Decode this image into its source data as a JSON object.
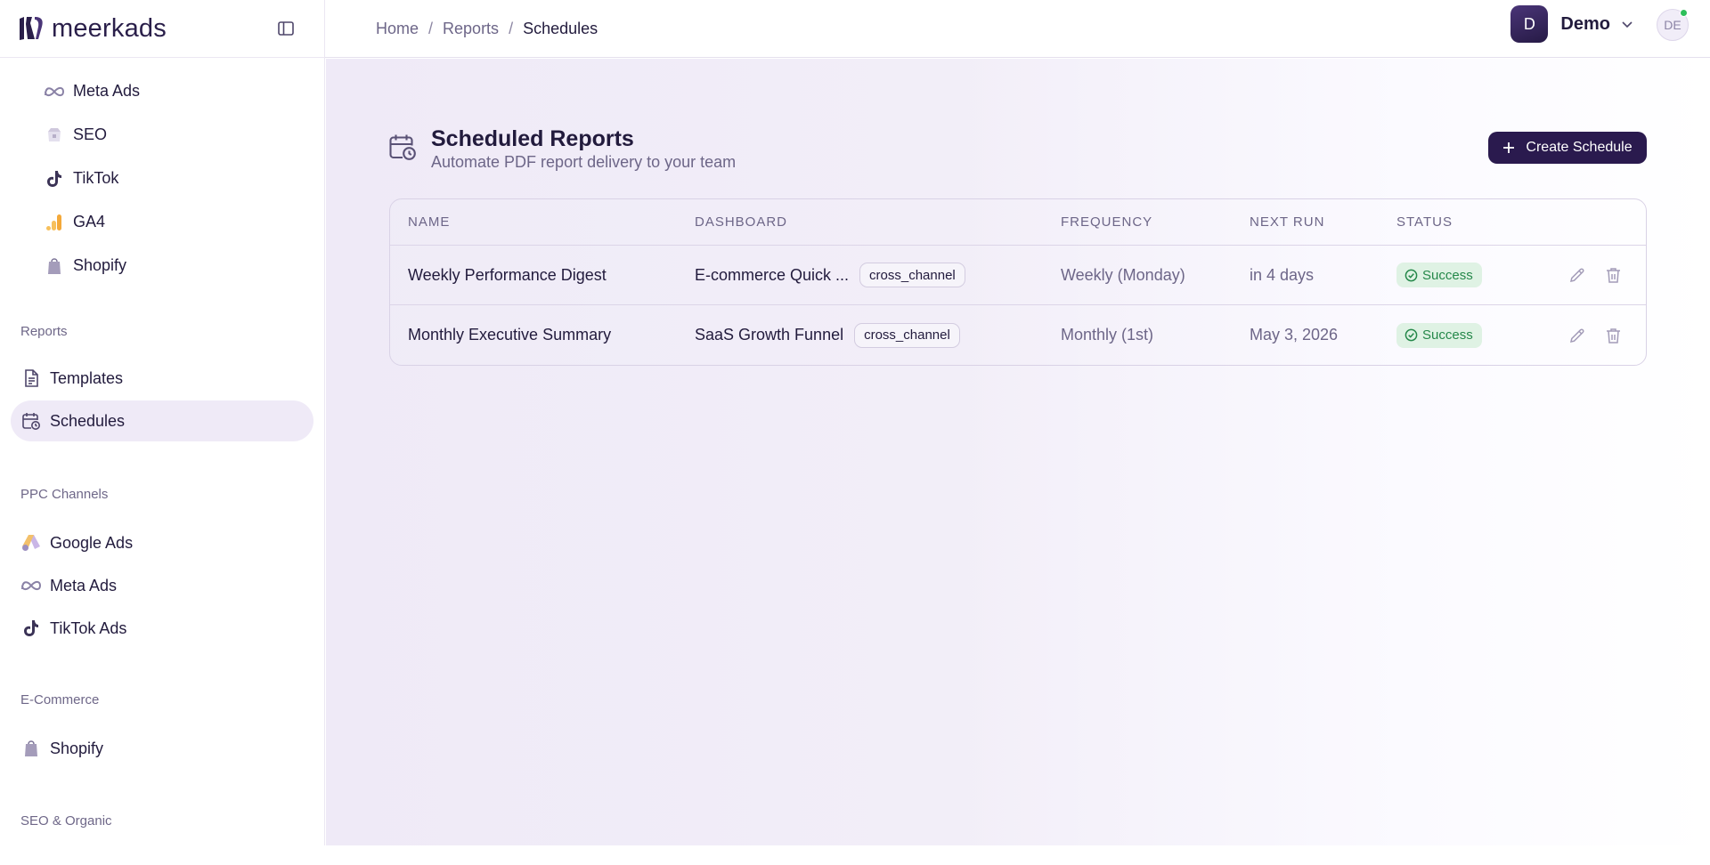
{
  "brand": {
    "name": "meerkads"
  },
  "sidebar": {
    "top_items": [
      {
        "label": "Meta Ads",
        "icon": "meta-icon"
      },
      {
        "label": "SEO",
        "icon": "seo-icon"
      },
      {
        "label": "TikTok",
        "icon": "tiktok-icon"
      },
      {
        "label": "GA4",
        "icon": "ga4-icon"
      },
      {
        "label": "Shopify",
        "icon": "shopify-icon"
      }
    ],
    "sections": [
      {
        "label": "Reports",
        "items": [
          {
            "label": "Templates",
            "icon": "document-icon"
          },
          {
            "label": "Schedules",
            "icon": "calendar-clock-icon",
            "active": true
          }
        ]
      },
      {
        "label": "PPC Channels",
        "items": [
          {
            "label": "Google Ads",
            "icon": "google-ads-icon"
          },
          {
            "label": "Meta Ads",
            "icon": "meta-icon"
          },
          {
            "label": "TikTok Ads",
            "icon": "tiktok-icon"
          }
        ]
      },
      {
        "label": "E-Commerce",
        "items": [
          {
            "label": "Shopify",
            "icon": "shopify-icon"
          }
        ]
      },
      {
        "label": "SEO & Organic",
        "items": []
      }
    ]
  },
  "breadcrumb": {
    "home": "Home",
    "reports": "Reports",
    "current": "Schedules",
    "separator": "/"
  },
  "user": {
    "initial": "D",
    "name": "Demo",
    "account_initials": "DE"
  },
  "page": {
    "title": "Scheduled Reports",
    "subtitle": "Automate PDF report delivery to your team",
    "create_button": "Create Schedule"
  },
  "table": {
    "columns": {
      "name": "NAME",
      "dashboard": "DASHBOARD",
      "frequency": "FREQUENCY",
      "next_run": "NEXT RUN",
      "status": "STATUS"
    },
    "rows": [
      {
        "name": "Weekly Performance Digest",
        "dashboard": "E-commerce Quick ...",
        "tag": "cross_channel",
        "frequency": "Weekly (Monday)",
        "next_run": "in 4 days",
        "status": "Success"
      },
      {
        "name": "Monthly Executive Summary",
        "dashboard": "SaaS Growth Funnel",
        "tag": "cross_channel",
        "frequency": "Monthly (1st)",
        "next_run": "May 3, 2026",
        "status": "Success"
      }
    ]
  },
  "colors": {
    "brand_dark": "#2a1a4e",
    "success_bg": "#dff2e4",
    "success_text": "#25884a",
    "active_nav": "#efeaf7",
    "online": "#2dbf5a"
  }
}
